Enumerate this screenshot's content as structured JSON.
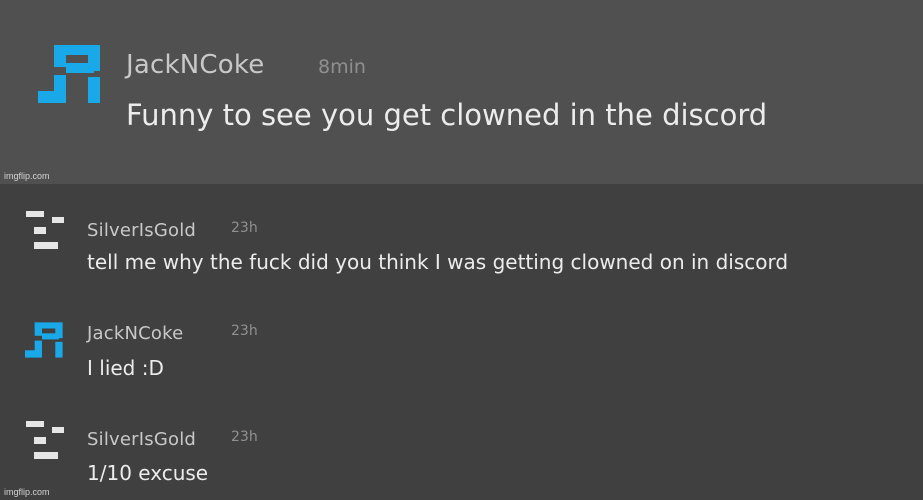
{
  "colors": {
    "top_panel_bg": "#505050",
    "bottom_panel_bg": "#404040",
    "avatar_accent": "#1aa9e8",
    "avatar_light": "#e6e6e6"
  },
  "watermarks": {
    "top": "imgflip.com",
    "bottom": "imgflip.com"
  },
  "comments": [
    {
      "username": "JackNCoke",
      "timestamp": "8min",
      "text": "Funny to see you get clowned in the discord",
      "avatar": "jr-pixel-avatar-icon"
    },
    {
      "username": "SilverIsGold",
      "timestamp": "23h",
      "text": "tell me why the fuck did you think I was getting clowned on in discord",
      "avatar": "dash-pixel-avatar-icon"
    },
    {
      "username": "JackNCoke",
      "timestamp": "23h",
      "text": "I lied :D",
      "avatar": "jr-pixel-avatar-icon"
    },
    {
      "username": "SilverIsGold",
      "timestamp": "23h",
      "text": "1/10 excuse",
      "avatar": "dash-pixel-avatar-icon"
    }
  ]
}
